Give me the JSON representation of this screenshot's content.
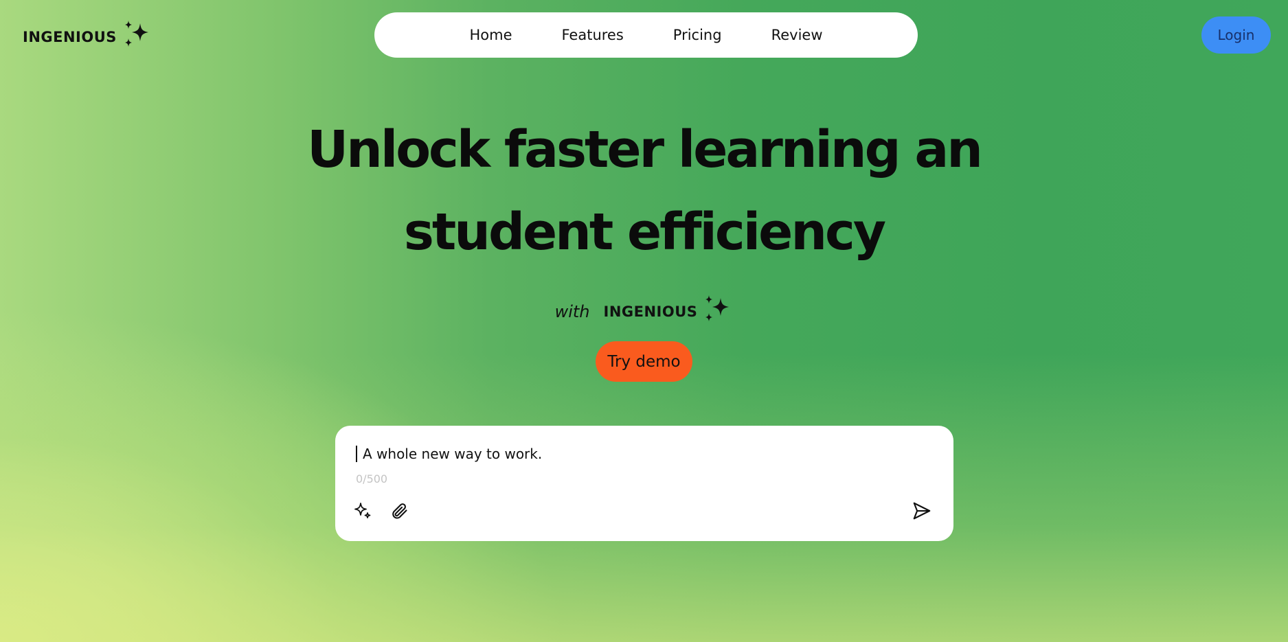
{
  "brand": {
    "name": "INGENIOUS",
    "icon": "sparkles-icon"
  },
  "nav": {
    "items": [
      {
        "label": "Home"
      },
      {
        "label": "Features"
      },
      {
        "label": "Pricing"
      },
      {
        "label": "Review"
      }
    ]
  },
  "header": {
    "login_label": "Login",
    "login_color": "#3d8ef5"
  },
  "hero": {
    "title_line1": "Unlock faster learning an",
    "title_line2": "student efficiency",
    "with_text": "with",
    "brand_name": "INGENIOUS",
    "demo_label": "Try demo",
    "demo_color": "#fa5b1e"
  },
  "composer": {
    "text": "A whole new way to work.",
    "counter": "0/500",
    "icons": [
      "sparkles-icon",
      "paperclip-icon",
      "send-icon"
    ]
  }
}
